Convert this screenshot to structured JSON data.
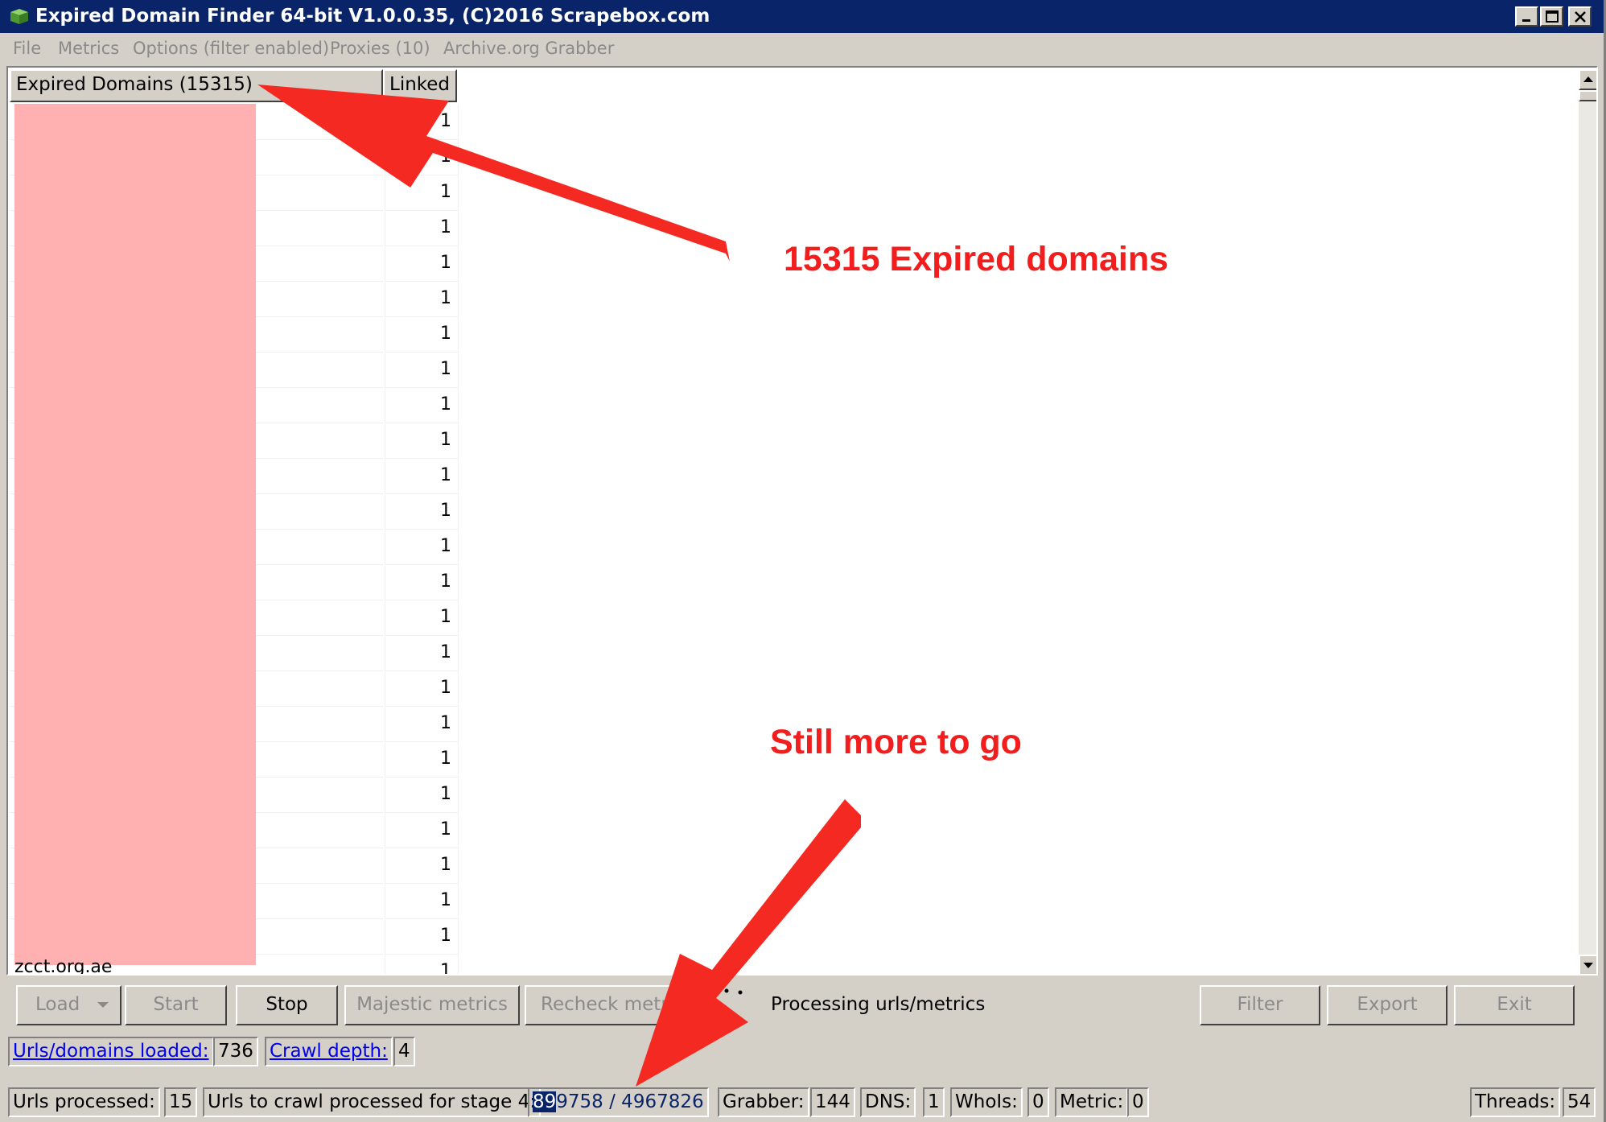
{
  "window": {
    "title": "Expired Domain Finder 64-bit V1.0.0.35, (C)2016 Scrapebox.com",
    "controls": [
      "minimize",
      "maximize",
      "close"
    ]
  },
  "menu": [
    {
      "label": "File"
    },
    {
      "label": "Metrics"
    },
    {
      "label": "Options (filter enabled)"
    },
    {
      "label": "Proxies (10)"
    },
    {
      "label": "Archive.org Grabber"
    }
  ],
  "table": {
    "headers": {
      "domain": "Expired Domains (15315)",
      "linked": "Linked"
    },
    "linked_values": [
      "1",
      "1",
      "1",
      "1",
      "1",
      "1",
      "1",
      "1",
      "1",
      "1",
      "1",
      "1",
      "1",
      "1",
      "1",
      "1",
      "1",
      "1",
      "1",
      "1",
      "1",
      "1",
      "1",
      "1",
      "1"
    ],
    "last_visible_domain": "zcct.org.ae"
  },
  "buttons": {
    "load": "Load",
    "start": "Start",
    "stop": "Stop",
    "majestic": "Majestic metrics",
    "recheck": "Recheck metrics",
    "filter": "Filter",
    "export": "Export",
    "exit": "Exit"
  },
  "status": {
    "message": "Processing urls/metrics",
    "urls_loaded_label": "Urls/domains loaded:",
    "urls_loaded_value": "736",
    "crawl_depth_label": "Crawl depth:",
    "crawl_depth_value": "4",
    "urls_processed_label": "Urls processed:",
    "urls_processed_value": "15",
    "stage_label": "Urls to crawl processed for stage 4:",
    "stage_value_highlight": "89",
    "stage_value_rest": "9758 / 4967826",
    "grabber_label": "Grabber:",
    "grabber_value": "144",
    "dns_label": "DNS:",
    "dns_value": "1",
    "whois_label": "WhoIs:",
    "whois_value": "0",
    "metric_label": "Metric:",
    "metric_value": "0",
    "threads_label": "Threads:",
    "threads_value": "54"
  },
  "annotations": {
    "top": "15315 Expired domains",
    "bottom": "Still more to go"
  },
  "colors": {
    "titlebar": "#0a246a",
    "annotation": "#f21d1d",
    "redaction": "#ffb1b1",
    "link": "#0000ee"
  }
}
